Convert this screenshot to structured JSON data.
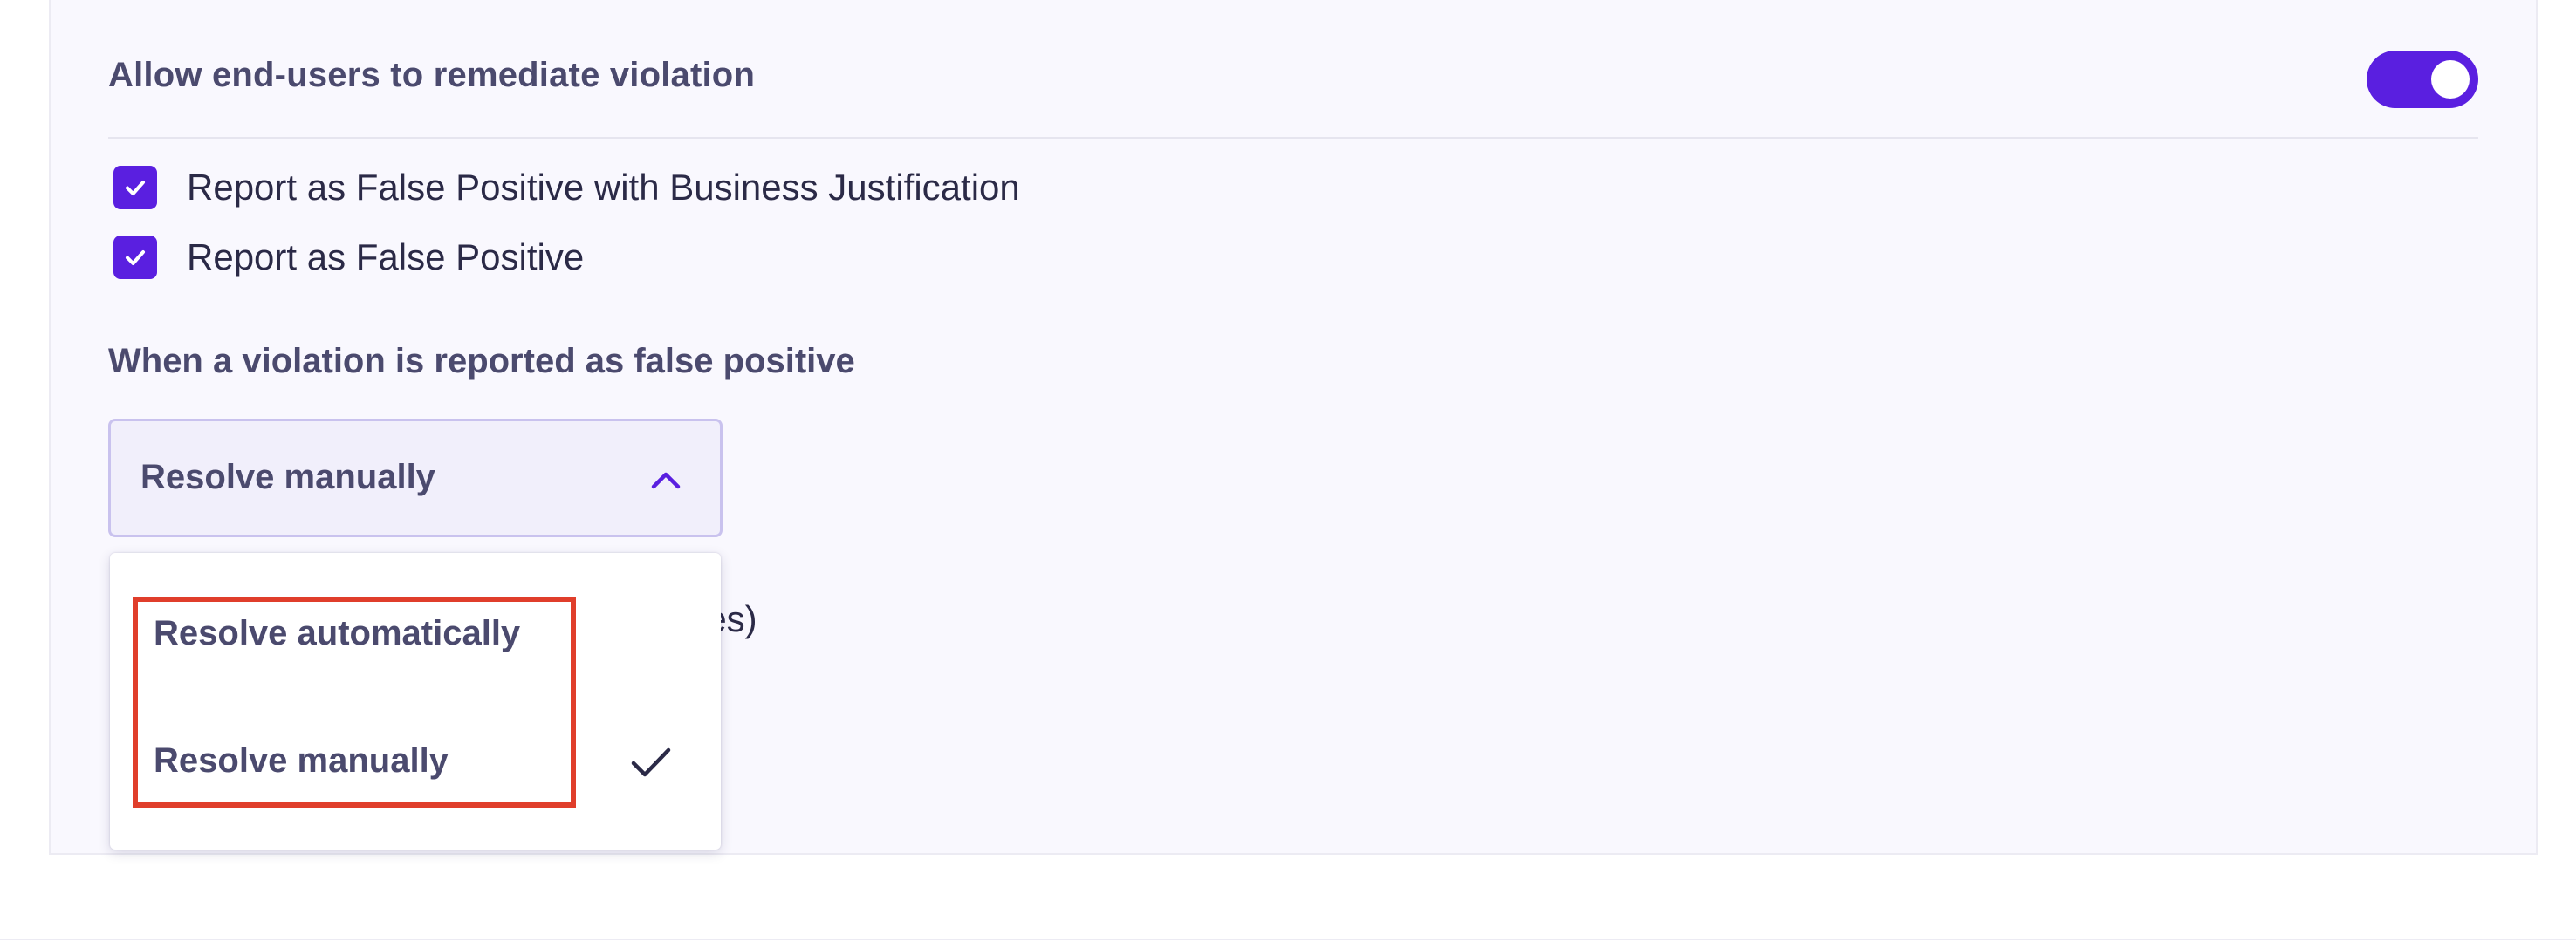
{
  "colors": {
    "accent": "#5a1fe0",
    "highlight": "#e03e2b",
    "panel_bg": "#f9f8fe"
  },
  "remediation": {
    "title": "Allow end-users to remediate violation",
    "toggle_on": true,
    "options": [
      {
        "label": "Report as False Positive with Business Justification",
        "checked": true
      },
      {
        "label": "Report as False Positive",
        "checked": true
      }
    ]
  },
  "false_positive": {
    "question": "When a violation is reported as false positive",
    "select": {
      "value": "Resolve manually",
      "expanded": true,
      "icon": "chevron-up-icon",
      "options": [
        {
          "label": "Resolve automatically",
          "selected": false
        },
        {
          "label": "Resolve manually",
          "selected": true,
          "icon": "check-icon"
        }
      ]
    },
    "obscured_text": "ires)"
  }
}
